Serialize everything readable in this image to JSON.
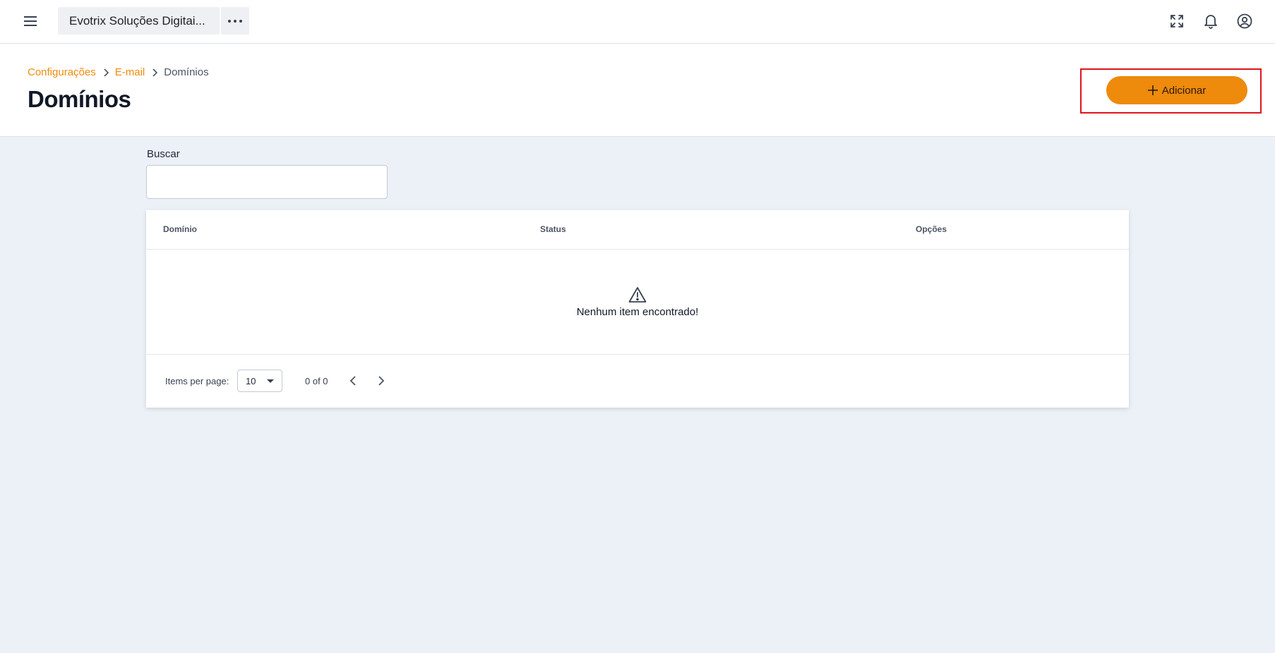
{
  "topbar": {
    "menu_icon": "hamburger-menu-icon",
    "org_name": "Evotrix Soluções Digitai...",
    "more_icon": "more-horizontal-icon",
    "icons": [
      "fullscreen-icon",
      "bell-icon",
      "user-circle-icon"
    ]
  },
  "header": {
    "breadcrumb": [
      "Configurações",
      "E-mail",
      "Domínios"
    ],
    "title": "Domínios",
    "add_button_label": "Adicionar",
    "add_button_icon": "plus-icon"
  },
  "search": {
    "label": "Buscar",
    "value": ""
  },
  "table": {
    "columns": [
      "Domínio",
      "Status",
      "Opções"
    ],
    "rows": [],
    "empty_message": "Nenhum item encontrado!",
    "empty_icon": "warning-triangle-icon"
  },
  "paginator": {
    "items_per_page_label": "Items per page:",
    "page_size": "10",
    "range_label": "0 of 0"
  },
  "colors": {
    "accent": "#ee8a0c",
    "background": "#ecf0f7",
    "highlight_border": "#e0141c"
  }
}
